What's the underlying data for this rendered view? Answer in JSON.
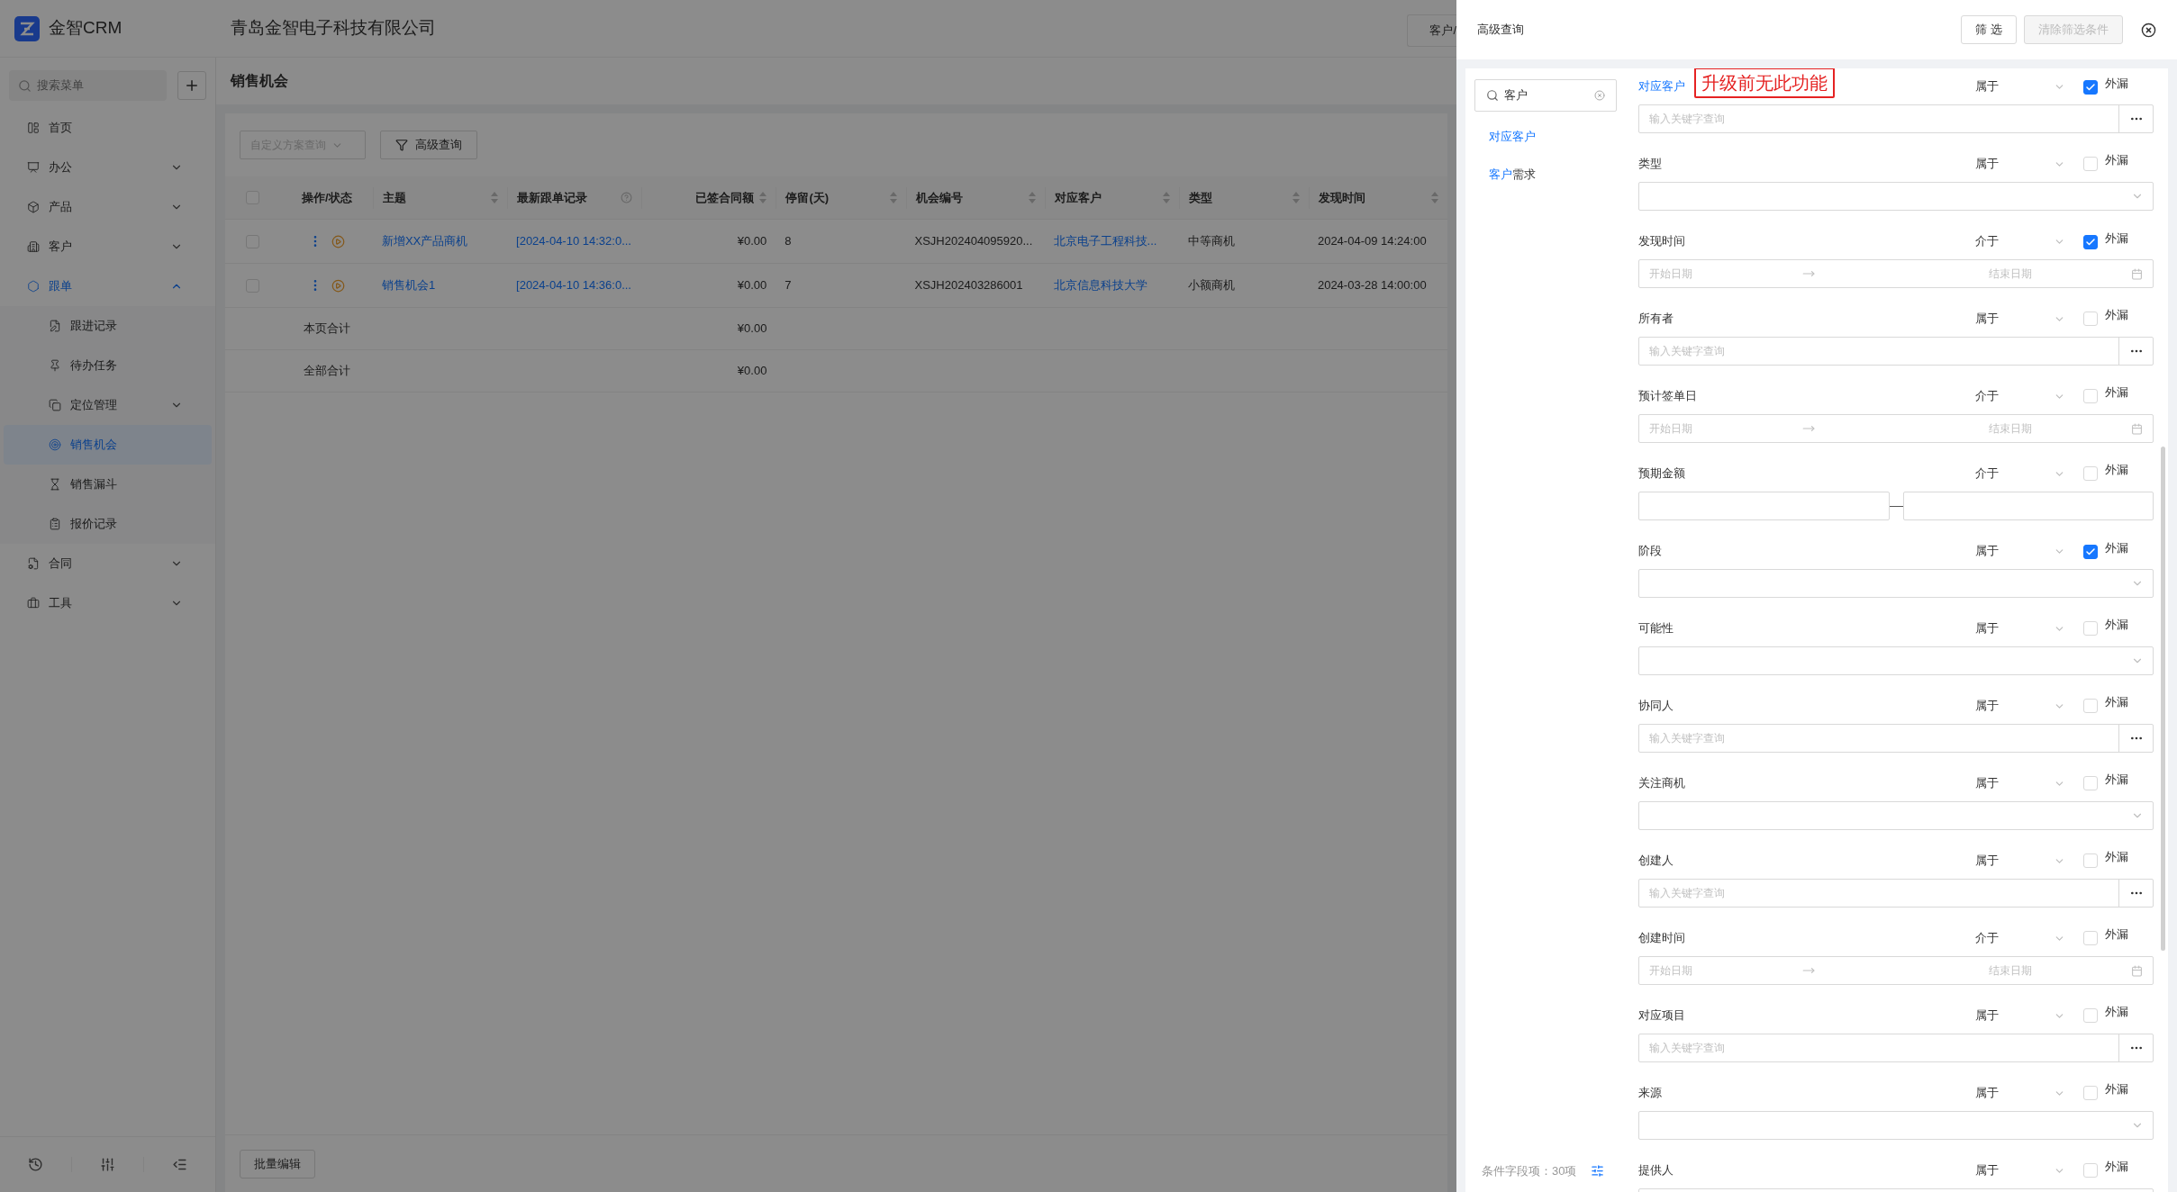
{
  "app": {
    "name": "金智CRM",
    "company": "青岛金智电子科技有限公司",
    "header_button": "客户/"
  },
  "sidebar": {
    "search_placeholder": "搜索菜单",
    "items": [
      {
        "label": "首页",
        "kind": "link",
        "selected": false
      },
      {
        "label": "办公",
        "kind": "group",
        "selected": false,
        "expanded": false
      },
      {
        "label": "产品",
        "kind": "group",
        "selected": false,
        "expanded": false
      },
      {
        "label": "客户",
        "kind": "group",
        "selected": false,
        "expanded": false
      },
      {
        "label": "跟单",
        "kind": "group",
        "selected": false,
        "expanded": true,
        "children": [
          {
            "label": "跟进记录",
            "kind": "link",
            "selected": false
          },
          {
            "label": "待办任务",
            "kind": "link",
            "selected": false
          },
          {
            "label": "定位管理",
            "kind": "group",
            "selected": false,
            "expanded": false
          },
          {
            "label": "销售机会",
            "kind": "link",
            "selected": true
          },
          {
            "label": "销售漏斗",
            "kind": "link",
            "selected": false
          },
          {
            "label": "报价记录",
            "kind": "link",
            "selected": false
          }
        ]
      },
      {
        "label": "合同",
        "kind": "group",
        "selected": false,
        "expanded": false
      },
      {
        "label": "工具",
        "kind": "group",
        "selected": false,
        "expanded": false
      }
    ]
  },
  "page": {
    "title": "销售机会",
    "scheme_placeholder": "自定义方案查询",
    "advanced_button": "高级查询",
    "batch_button": "批量编辑"
  },
  "table": {
    "all_checked": false,
    "columns": [
      {
        "label": "操作/状态",
        "kind": "actions",
        "sortable": false,
        "help": false
      },
      {
        "label": "主题",
        "kind": "link",
        "sortable": true,
        "help": false
      },
      {
        "label": "最新跟单记录",
        "kind": "link",
        "sortable": false,
        "help": true
      },
      {
        "label": "已签合同额",
        "kind": "money",
        "sortable": true,
        "help": false
      },
      {
        "label": "停留(天)",
        "kind": "text",
        "sortable": true,
        "help": false
      },
      {
        "label": "机会编号",
        "kind": "text",
        "sortable": true,
        "help": false
      },
      {
        "label": "对应客户",
        "kind": "link",
        "sortable": true,
        "help": false
      },
      {
        "label": "类型",
        "kind": "text",
        "sortable": true,
        "help": false
      },
      {
        "label": "发现时间",
        "kind": "text",
        "sortable": true,
        "help": false
      }
    ],
    "rows": [
      {
        "checked": false,
        "cells": [
          "",
          "新增XX产品商机",
          "[2024-04-10 14:32:0...",
          "¥0.00",
          "8",
          "XSJH202404095920...",
          "北京电子工程科技...",
          "中等商机",
          "2024-04-09 14:24:00"
        ]
      },
      {
        "checked": false,
        "cells": [
          "",
          "销售机会1",
          "[2024-04-10 14:36:0...",
          "¥0.00",
          "7",
          "XSJH202403286001",
          "北京信息科技大学",
          "小额商机",
          "2024-03-28 14:00:00"
        ]
      }
    ],
    "totals": [
      {
        "label": "本页合计",
        "amount": "¥0.00"
      },
      {
        "label": "全部合计",
        "amount": "¥0.00"
      }
    ]
  },
  "drawer": {
    "title": "高级查询",
    "buttons": [
      {
        "label": "筛 选",
        "disabled": false
      },
      {
        "label": "清除筛选条件",
        "disabled": true
      }
    ],
    "search_value": "客户",
    "matches": [
      {
        "parts": [
          {
            "text": "对应客户",
            "highlight": true
          }
        ]
      },
      {
        "parts": [
          {
            "text": "客户",
            "highlight": true
          },
          {
            "text": "需求",
            "highlight": false
          }
        ]
      }
    ],
    "field_count": "条件字段项：30项",
    "fields": [
      {
        "label": "对应客户",
        "highlight": true,
        "annotation": "升级前无此功能",
        "operator": "属于",
        "leak": true,
        "leak_label": "外漏",
        "input": {
          "kind": "keyword",
          "placeholder": "输入关键字查询"
        }
      },
      {
        "label": "类型",
        "highlight": false,
        "operator": "属于",
        "leak": false,
        "leak_label": "外漏",
        "input": {
          "kind": "select"
        }
      },
      {
        "label": "发现时间",
        "highlight": false,
        "operator": "介于",
        "leak": true,
        "leak_label": "外漏",
        "input": {
          "kind": "daterange",
          "start_placeholder": "开始日期",
          "end_placeholder": "结束日期"
        }
      },
      {
        "label": "所有者",
        "highlight": false,
        "operator": "属于",
        "leak": false,
        "leak_label": "外漏",
        "input": {
          "kind": "keyword",
          "placeholder": "输入关键字查询"
        }
      },
      {
        "label": "预计签单日",
        "highlight": false,
        "operator": "介于",
        "leak": false,
        "leak_label": "外漏",
        "input": {
          "kind": "daterange",
          "start_placeholder": "开始日期",
          "end_placeholder": "结束日期"
        }
      },
      {
        "label": "预期金额",
        "highlight": false,
        "operator": "介于",
        "leak": false,
        "leak_label": "外漏",
        "input": {
          "kind": "numrange"
        }
      },
      {
        "label": "阶段",
        "highlight": false,
        "operator": "属于",
        "leak": true,
        "leak_label": "外漏",
        "input": {
          "kind": "select"
        }
      },
      {
        "label": "可能性",
        "highlight": false,
        "operator": "属于",
        "leak": false,
        "leak_label": "外漏",
        "input": {
          "kind": "select"
        }
      },
      {
        "label": "协同人",
        "highlight": false,
        "operator": "属于",
        "leak": false,
        "leak_label": "外漏",
        "input": {
          "kind": "keyword",
          "placeholder": "输入关键字查询"
        }
      },
      {
        "label": "关注商机",
        "highlight": false,
        "operator": "属于",
        "leak": false,
        "leak_label": "外漏",
        "input": {
          "kind": "select"
        }
      },
      {
        "label": "创建人",
        "highlight": false,
        "operator": "属于",
        "leak": false,
        "leak_label": "外漏",
        "input": {
          "kind": "keyword",
          "placeholder": "输入关键字查询"
        }
      },
      {
        "label": "创建时间",
        "highlight": false,
        "operator": "介于",
        "leak": false,
        "leak_label": "外漏",
        "input": {
          "kind": "daterange",
          "start_placeholder": "开始日期",
          "end_placeholder": "结束日期"
        }
      },
      {
        "label": "对应项目",
        "highlight": false,
        "operator": "属于",
        "leak": false,
        "leak_label": "外漏",
        "input": {
          "kind": "keyword",
          "placeholder": "输入关键字查询"
        }
      },
      {
        "label": "来源",
        "highlight": false,
        "operator": "属于",
        "leak": false,
        "leak_label": "外漏",
        "input": {
          "kind": "select"
        }
      },
      {
        "label": "提供人",
        "highlight": false,
        "operator": "属于",
        "leak": false,
        "leak_label": "外漏",
        "input": {
          "kind": "cut"
        }
      }
    ]
  }
}
